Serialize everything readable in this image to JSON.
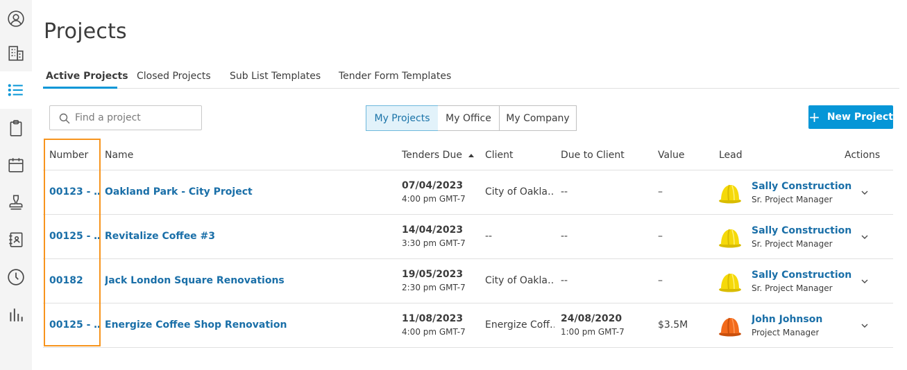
{
  "sidebar": {
    "items": [
      {
        "icon": "user-circle-icon"
      },
      {
        "icon": "building-icon"
      },
      {
        "icon": "list-icon",
        "active": true
      },
      {
        "icon": "clipboard-icon"
      },
      {
        "icon": "calendar-icon"
      },
      {
        "icon": "stamp-icon"
      },
      {
        "icon": "address-book-icon"
      },
      {
        "icon": "clock-icon"
      },
      {
        "icon": "bar-chart-icon"
      }
    ]
  },
  "page": {
    "title": "Projects"
  },
  "tabs": [
    {
      "label": "Active Projects",
      "active": true
    },
    {
      "label": "Closed Projects"
    },
    {
      "label": "Sub List Templates"
    },
    {
      "label": "Tender Form Templates"
    }
  ],
  "search": {
    "placeholder": "Find a project",
    "value": ""
  },
  "filters": {
    "options": [
      "My Projects",
      "My Office",
      "My Company"
    ],
    "selected": "My Projects"
  },
  "actions": {
    "new_project_label": "New Project",
    "new_project_icon": "+"
  },
  "table": {
    "columns": {
      "number": "Number",
      "name": "Name",
      "tenders_due": "Tenders Due",
      "client": "Client",
      "due_to_client": "Due to Client",
      "value": "Value",
      "lead": "Lead",
      "actions": "Actions"
    },
    "sort": {
      "column": "Tenders Due",
      "direction": "ascending"
    },
    "rows": [
      {
        "number": "00123 - …",
        "name": "Oakland Park - City Project",
        "tenders_due_date": "07/04/2023",
        "tenders_due_time": "4:00 pm GMT-7",
        "client": "City of Oakla…",
        "due_to_client_date": "--",
        "due_to_client_time": "",
        "value": "–",
        "lead_name": "Sally Construction",
        "lead_role": "Sr. Project Manager",
        "lead_hat_color": "#f5d90a"
      },
      {
        "number": "00125 - …",
        "name": "Revitalize Coffee #3",
        "tenders_due_date": "14/04/2023",
        "tenders_due_time": "3:30 pm GMT-7",
        "client": "--",
        "due_to_client_date": "--",
        "due_to_client_time": "",
        "value": "–",
        "lead_name": "Sally Construction",
        "lead_role": "Sr. Project Manager",
        "lead_hat_color": "#f5d90a"
      },
      {
        "number": "00182",
        "name": "Jack London Square Renovations",
        "tenders_due_date": "19/05/2023",
        "tenders_due_time": "2:30 pm GMT-7",
        "client": "City of Oakla…",
        "due_to_client_date": "--",
        "due_to_client_time": "",
        "value": "–",
        "lead_name": "Sally Construction",
        "lead_role": "Sr. Project Manager",
        "lead_hat_color": "#f5d90a"
      },
      {
        "number": "00125 - …",
        "name": "Energize Coffee Shop Renovation",
        "tenders_due_date": "11/08/2023",
        "tenders_due_time": "4:00 pm GMT-7",
        "client": "Energize Coff…",
        "due_to_client_date": "24/08/2020",
        "due_to_client_time": "1:00 pm GMT-7",
        "value": "$3.5M",
        "lead_name": "John Johnson",
        "lead_role": "Project Manager",
        "lead_hat_color": "#f26a1b"
      }
    ]
  },
  "colors": {
    "accent": "#0696d7",
    "link": "#1a6fa8",
    "highlight_border": "#f7941d",
    "selected_filter_bg": "#e2f2fa"
  }
}
